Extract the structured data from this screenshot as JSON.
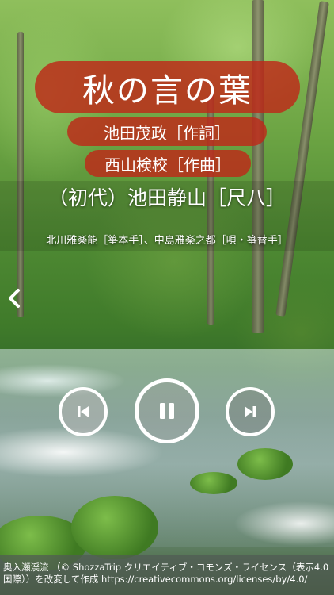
{
  "song": {
    "title": "秋の言の葉",
    "lyricist": "池田茂政［作詞］",
    "composer": "西山検校［作曲］"
  },
  "performers": {
    "main": "（初代）池田静山［尺八］",
    "others": "北川雅楽能［箏本手］、中島雅楽之都［唄・箏替手］"
  },
  "controls": {
    "back_icon": "chevron-left-icon",
    "prev_icon": "skip-previous-icon",
    "play_icon": "pause-icon",
    "next_icon": "skip-next-icon"
  },
  "credit": {
    "text": "奥入瀬渓流 （© ShozzaTrip クリエイティブ・コモンズ・ライセンス（表示4.0国際））を改変して作成 https://creativecommons.org/licenses/by/4.0/"
  },
  "colors": {
    "pill": "#be2819",
    "text": "#ffffff"
  }
}
